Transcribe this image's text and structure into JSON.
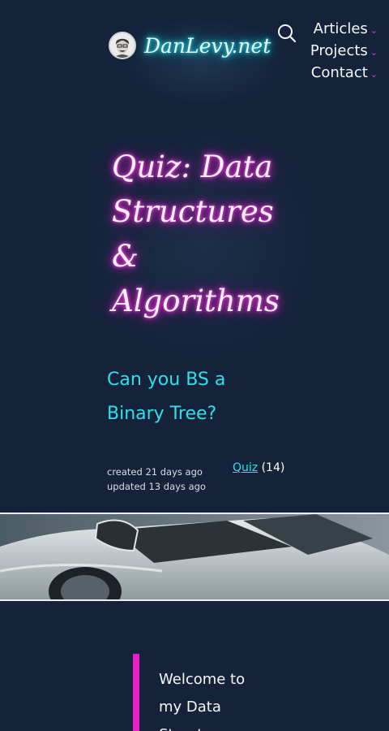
{
  "site": {
    "logo_text": "DanLevy.net",
    "avatar_icon": "avatar-photo"
  },
  "nav": {
    "search_icon": "search-icon",
    "items": [
      {
        "label": "Articles",
        "chevron": "⌄"
      },
      {
        "label": "Projects",
        "chevron": "⌄"
      },
      {
        "label": "Contact",
        "chevron": "⌄"
      }
    ]
  },
  "article": {
    "title": "Quiz: Data Structures & Algorithms",
    "subtitle": "Can you BS a Binary Tree?",
    "created": "created 21 days ago",
    "updated": "updated 13 days ago",
    "tag_label": "Quiz",
    "tag_count": "(14)",
    "banner_alt": "silver sports car",
    "intro_text": "Welcome to my Data Structures"
  },
  "colors": {
    "background": "#14233a",
    "accent_cyan": "#2fe0ea",
    "accent_magenta": "#e820c8"
  }
}
